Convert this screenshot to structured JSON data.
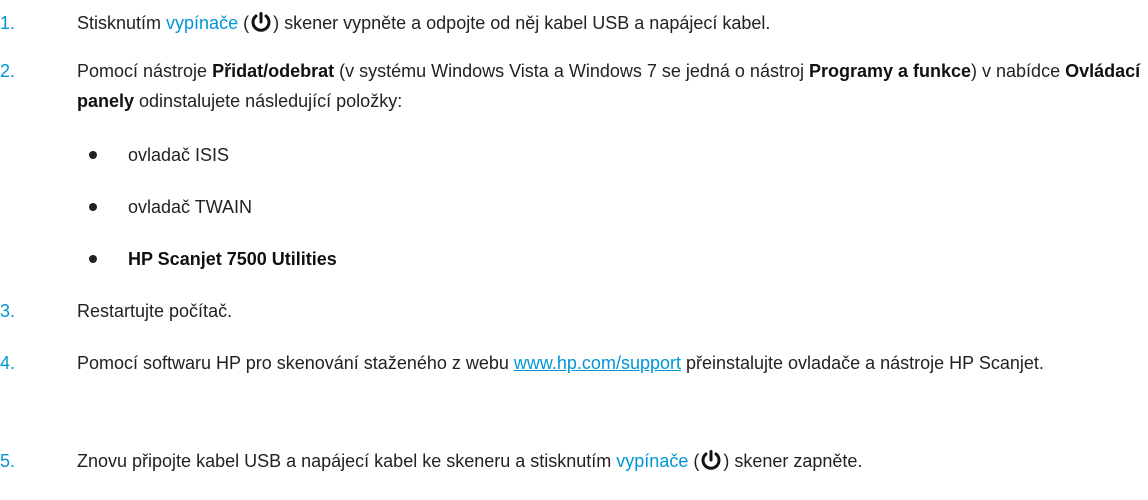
{
  "steps": [
    {
      "number": "1.",
      "before_link": "Stisknutím ",
      "link": "vypínače",
      "after_link_pre_icon": " (",
      "icon": "power-button-icon",
      "after_icon": ") skener vypněte a odpojte od něj kabel USB a napájecí kabel."
    },
    {
      "number": "2.",
      "part1": "Pomocí nástroje ",
      "bold1": "Přidat/odebrat",
      "part2": " (v systému Windows Vista a Windows 7 se jedná o nástroj ",
      "bold2": "Programy a funkce",
      "part3": ") v nabídce ",
      "bold3": "Ovládací panely",
      "part4": " odinstalujete následující položky:",
      "bullets": [
        "ovladač ISIS",
        "ovladač TWAIN",
        "HP Scanjet 7500 Utilities"
      ]
    },
    {
      "number": "3.",
      "text": "Restartujte počítač."
    },
    {
      "number": "4.",
      "before_url": "Pomocí softwaru HP pro skenování staženého z webu ",
      "url": "www.hp.com/support",
      "after_url": " přeinstalujte ovladače a nástroje HP Scanjet."
    },
    {
      "number": "5.",
      "before_link": "Znovu připojte kabel USB a napájecí kabel ke skeneru a stisknutím ",
      "link": "vypínače",
      "after_link_pre_icon": " (",
      "icon": "power-button-icon",
      "after_icon": ") skener zapněte."
    }
  ],
  "colors": {
    "accent": "#0096d6",
    "text": "#222222"
  }
}
